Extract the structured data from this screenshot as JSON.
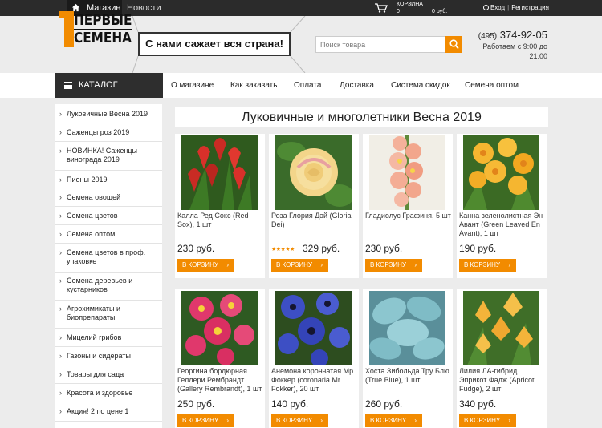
{
  "topbar": {
    "shop": "Магазин",
    "news": "Новости",
    "cart_label": "КОРЗИНА",
    "cart_count": "0",
    "cart_sum": "0 руб.",
    "login": "Вход",
    "register": "Регистрация"
  },
  "header": {
    "logo_line1": "ПЕРВЫЕ",
    "logo_line2": "СЕМЕНА",
    "slogan": "С нами сажает вся страна!",
    "search_placeholder": "Поиск товара",
    "phone_code": "(495)",
    "phone_number": "374-92-05",
    "hours_line1": "Работаем с 9:00 до",
    "hours_line2": "21:00"
  },
  "nav": {
    "catalog": "КАТАЛОГ",
    "items": [
      "О магазине",
      "Как заказать",
      "Оплата",
      "Доставка",
      "Система скидок",
      "Семена оптом"
    ]
  },
  "sidebar": [
    "Луковичные Весна 2019",
    "Саженцы роз 2019",
    "НОВИНКА! Саженцы винограда 2019",
    "Пионы 2019",
    "Семена овощей",
    "Семена цветов",
    "Семена оптом",
    "Семена цветов в проф. упаковке",
    "Семена деревьев и кустарников",
    "Агрохимикаты и биопрепараты",
    "Мицелий грибов",
    "Газоны и сидераты",
    "Товары для сада",
    "Красота и здоровье",
    "Акция! 2 по цене 1"
  ],
  "page_title": "Луковичные и многолетники Весна 2019",
  "products": [
    {
      "name": "Калла Ред Сокс (Red Sox), 1 шт",
      "price": "230 руб.",
      "button": "В КОРЗИНУ"
    },
    {
      "name": "Роза Глория Дэй (Gloria Dei)",
      "price": "329 руб.",
      "stars": "★★★★★",
      "rating": 5,
      "button": "В КОРЗИНУ"
    },
    {
      "name": "Гладиолус Графиня, 5 шт",
      "price": "230 руб.",
      "button": "В КОРЗИНУ"
    },
    {
      "name": "Канна зеленолистная Эн Авант (Green Leaved En Avant), 1 шт",
      "price": "190 руб.",
      "button": "В КОРЗИНУ"
    },
    {
      "name": "Георгина бордюрная Геллери Рембрандт (Gallery Rembrandt), 1 шт",
      "price": "250 руб.",
      "button": "В КОРЗИНУ"
    },
    {
      "name": "Анемона корончатая Мр. Фоккер (coronaria Mr. Fokker), 20 шт",
      "price": "140 руб.",
      "button": "В КОРЗИНУ"
    },
    {
      "name": "Хоста Зибольда Тру Блю (True Blue), 1 шт",
      "price": "260 руб.",
      "button": "В КОРЗИНУ"
    },
    {
      "name": "Лилия ЛА-гибрид Эприкот Фадж (Apricot Fudge), 2 шт",
      "price": "340 руб.",
      "button": "В КОРЗИНУ"
    }
  ],
  "colors": {
    "accent": "#f28b00",
    "topbar": "#2b2b2b",
    "catalog": "#2e2e2e",
    "background": "#ececec"
  }
}
